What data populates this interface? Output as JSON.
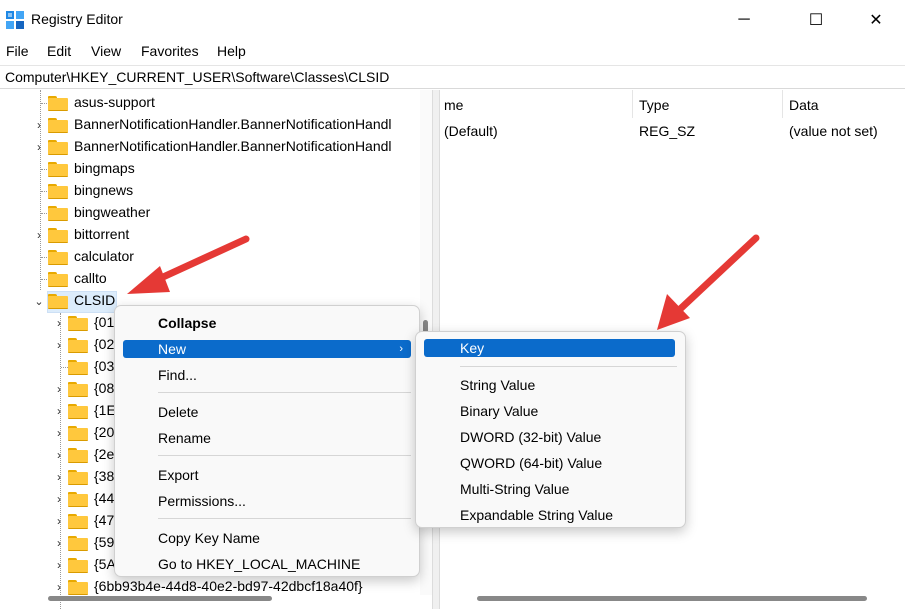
{
  "window": {
    "title": "Registry Editor",
    "minimize_glyph": "─",
    "maximize_glyph": "☐",
    "close_glyph": "✕"
  },
  "menu": [
    "File",
    "Edit",
    "View",
    "Favorites",
    "Help"
  ],
  "address": "Computer\\HKEY_CURRENT_USER\\Software\\Classes\\CLSID",
  "tree": {
    "nodes": [
      {
        "label": "asus-support",
        "expandable": false
      },
      {
        "label": "BannerNotificationHandler.BannerNotificationHandl",
        "expandable": true
      },
      {
        "label": "BannerNotificationHandler.BannerNotificationHandl",
        "expandable": true
      },
      {
        "label": "bingmaps",
        "expandable": false
      },
      {
        "label": "bingnews",
        "expandable": false
      },
      {
        "label": "bingweather",
        "expandable": false
      },
      {
        "label": "bittorrent",
        "expandable": true
      },
      {
        "label": "calculator",
        "expandable": false
      },
      {
        "label": "callto",
        "expandable": false
      }
    ],
    "selected": {
      "label": "CLSID",
      "expanded": true
    },
    "children": [
      {
        "label": "{01",
        "expandable": true
      },
      {
        "label": "{02",
        "expandable": true
      },
      {
        "label": "{03",
        "expandable": false
      },
      {
        "label": "{08",
        "expandable": true
      },
      {
        "label": "{1E",
        "expandable": true
      },
      {
        "label": "{20",
        "expandable": true
      },
      {
        "label": "{2e",
        "expandable": true
      },
      {
        "label": "{38",
        "expandable": true
      },
      {
        "label": "{44",
        "expandable": true
      },
      {
        "label": "{47",
        "expandable": true
      },
      {
        "label": "{59",
        "expandable": true
      },
      {
        "label": "{5A",
        "expandable": true
      },
      {
        "label": "{6bb93b4e-44d8-40e2-bd97-42dbcf18a40f}",
        "expandable": true
      }
    ]
  },
  "values_list": {
    "columns": [
      "me",
      "Type",
      "Data"
    ],
    "rows": [
      {
        "name": "(Default)",
        "type": "REG_SZ",
        "data": "(value not set)"
      }
    ]
  },
  "context_menu": {
    "items": [
      {
        "label": "Collapse",
        "bold": true
      },
      {
        "label": "New",
        "highlighted": true,
        "submenu_glyph": "›"
      },
      {
        "label": "Find..."
      },
      {
        "label": "Delete"
      },
      {
        "label": "Rename"
      },
      {
        "label": "Export"
      },
      {
        "label": "Permissions..."
      },
      {
        "label": "Copy Key Name"
      },
      {
        "label": "Go to HKEY_LOCAL_MACHINE"
      }
    ]
  },
  "new_submenu": {
    "items": [
      {
        "label": "Key",
        "highlighted": true
      },
      {
        "label": "String Value"
      },
      {
        "label": "Binary Value"
      },
      {
        "label": "DWORD (32-bit) Value"
      },
      {
        "label": "QWORD (64-bit) Value"
      },
      {
        "label": "Multi-String Value"
      },
      {
        "label": "Expandable String Value"
      }
    ]
  },
  "colors": {
    "highlight": "#0b6bcb",
    "annotation_arrow": "#e53935",
    "folder": "#ffc83d"
  }
}
